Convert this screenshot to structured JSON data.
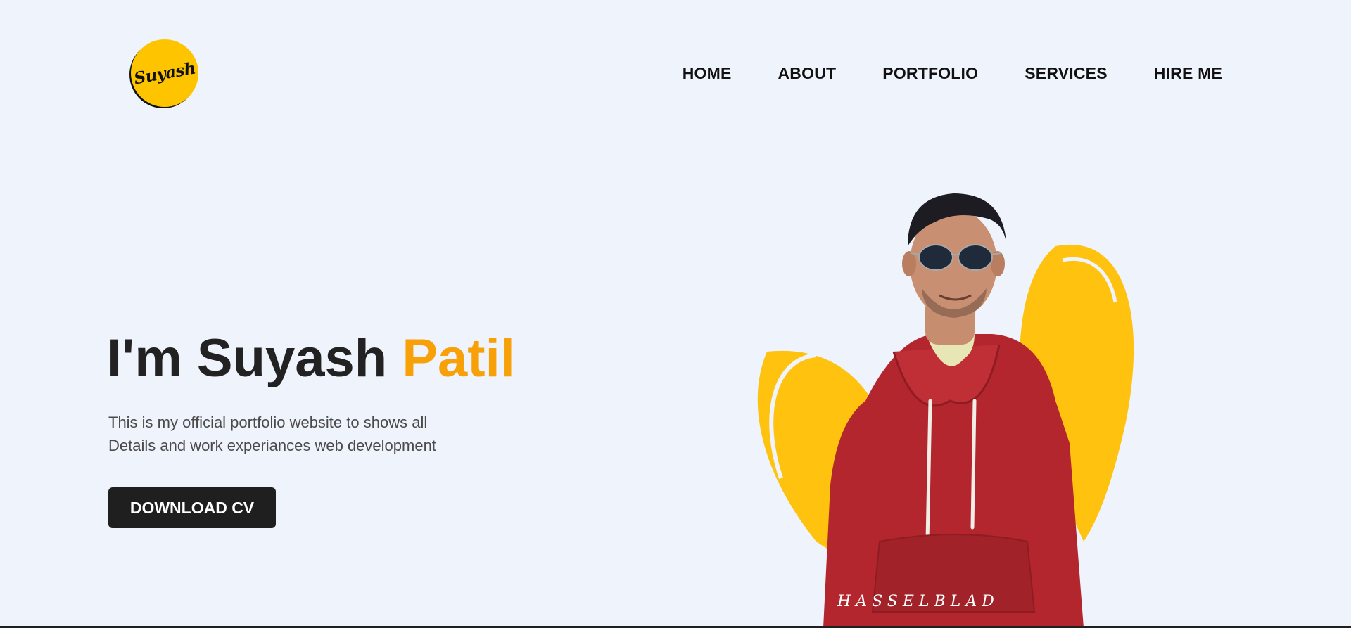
{
  "header": {
    "logo_text": "Suyash",
    "nav": [
      "HOME",
      "ABOUT",
      "PORTFOLIO",
      "SERVICES",
      "HIRE ME"
    ]
  },
  "hero": {
    "title_main": "I'm Suyash ",
    "title_accent": "Patil",
    "description_line1": "This is my official portfolio website to shows all",
    "description_line2": "Details and work experiances web development",
    "cta_label": "DOWNLOAD CV"
  },
  "portrait": {
    "brand_text": "HASSELBLAD"
  },
  "colors": {
    "background": "#eff3fc",
    "accent": "#f7a007",
    "logo_yellow": "#ffc400",
    "heart_yellow": "#ffc20e",
    "hoodie": "#b3262e",
    "button": "#1f1f1f"
  }
}
